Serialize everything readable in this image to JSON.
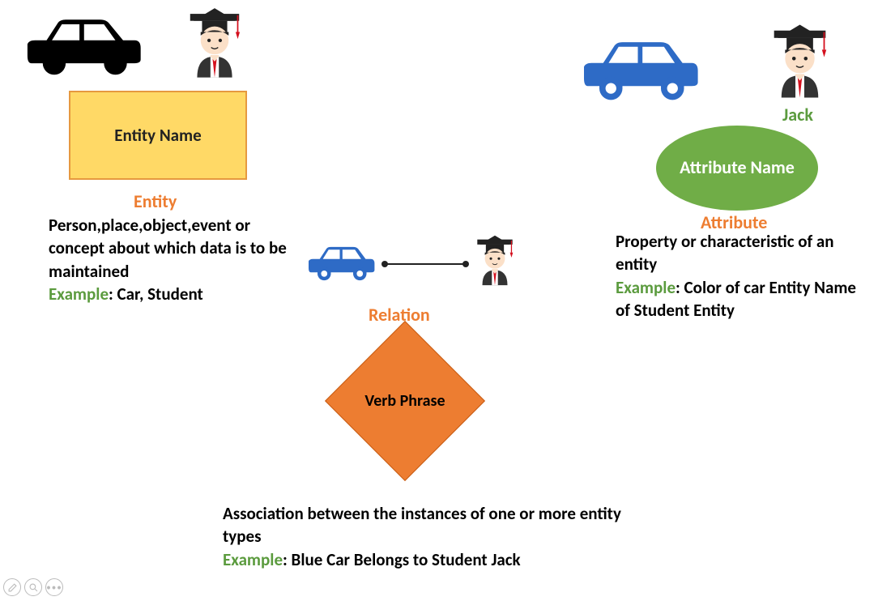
{
  "entity": {
    "box_label": "Entity Name",
    "title": "Entity",
    "desc": "Person,place,object,event or concept about which data is to be maintained",
    "example_label": "Example",
    "example_text": ": Car, Student"
  },
  "attribute": {
    "jack_label": "Jack",
    "ellipse_label": "Attribute Name",
    "title": "Attribute",
    "desc": "Property or characteristic of an entity",
    "example_label": "Example",
    "example_text": ": Color of car Entity Name of Student Entity"
  },
  "relation": {
    "title": "Relation",
    "diamond_label": "Verb Phrase",
    "desc": "Association between the instances of one or more entity types",
    "example_label": "Example",
    "example_text": ": Blue Car Belongs to Student Jack"
  }
}
